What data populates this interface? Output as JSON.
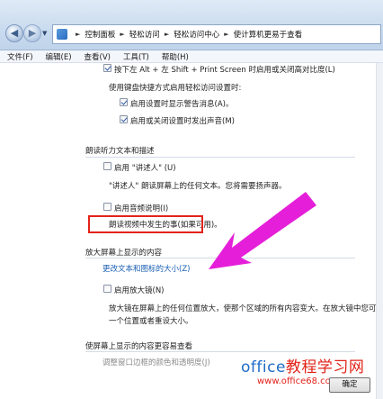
{
  "address": {
    "crumbs": [
      "控制面板",
      "轻松访问",
      "轻松访问中心",
      "使计算机更易于查看"
    ]
  },
  "menu": [
    "文件(F)",
    "编辑(E)",
    "查看(V)",
    "工具(T)",
    "帮助(H)"
  ],
  "hc": {
    "shortcut_label": "按下左 Alt + 左 Shift + Print Screen 时启用或关闭高对比度(L)",
    "when_using": "使用键盘快捷方式启用轻松访问设置时:",
    "warning_label": "启用设置时显示警告消息(A)。",
    "sound_label": "启用或关闭设置时发出声音(M)"
  },
  "narrator": {
    "heading": "朗读听力文本和描述",
    "enable_label": "启用 \"讲述人\" (U)",
    "desc": "\"讲述人\" 朗读屏幕上的任何文本。您将需要扬声器。",
    "audio_label": "启用音频说明(I)",
    "audio_desc": "朗读视频中发生的事(如果可用)。"
  },
  "magnify": {
    "heading": "放大屏幕上显示的内容",
    "link": "更改文本和图标的大小(Z)",
    "enable_label": "启用放大镜(N)",
    "desc1": "放大镜在屏幕上的任何位置放大，使那个区域的所有内容变大。在放大镜中您可以",
    "desc2": "一个位置或者重设大小。"
  },
  "easier": {
    "heading": "使屏幕上显示的内容更容易查看",
    "partial": "调整窗口边框的颜色和透明度(J)"
  },
  "ok_button": "确定",
  "watermark": {
    "main_latin": "office",
    "main_cn": "教程学习网",
    "url": "www.office68.com"
  },
  "colors": {
    "accent_arrow": "#e51fd9",
    "highlight_border": "#e2231a",
    "link": "#1a5fb4"
  }
}
